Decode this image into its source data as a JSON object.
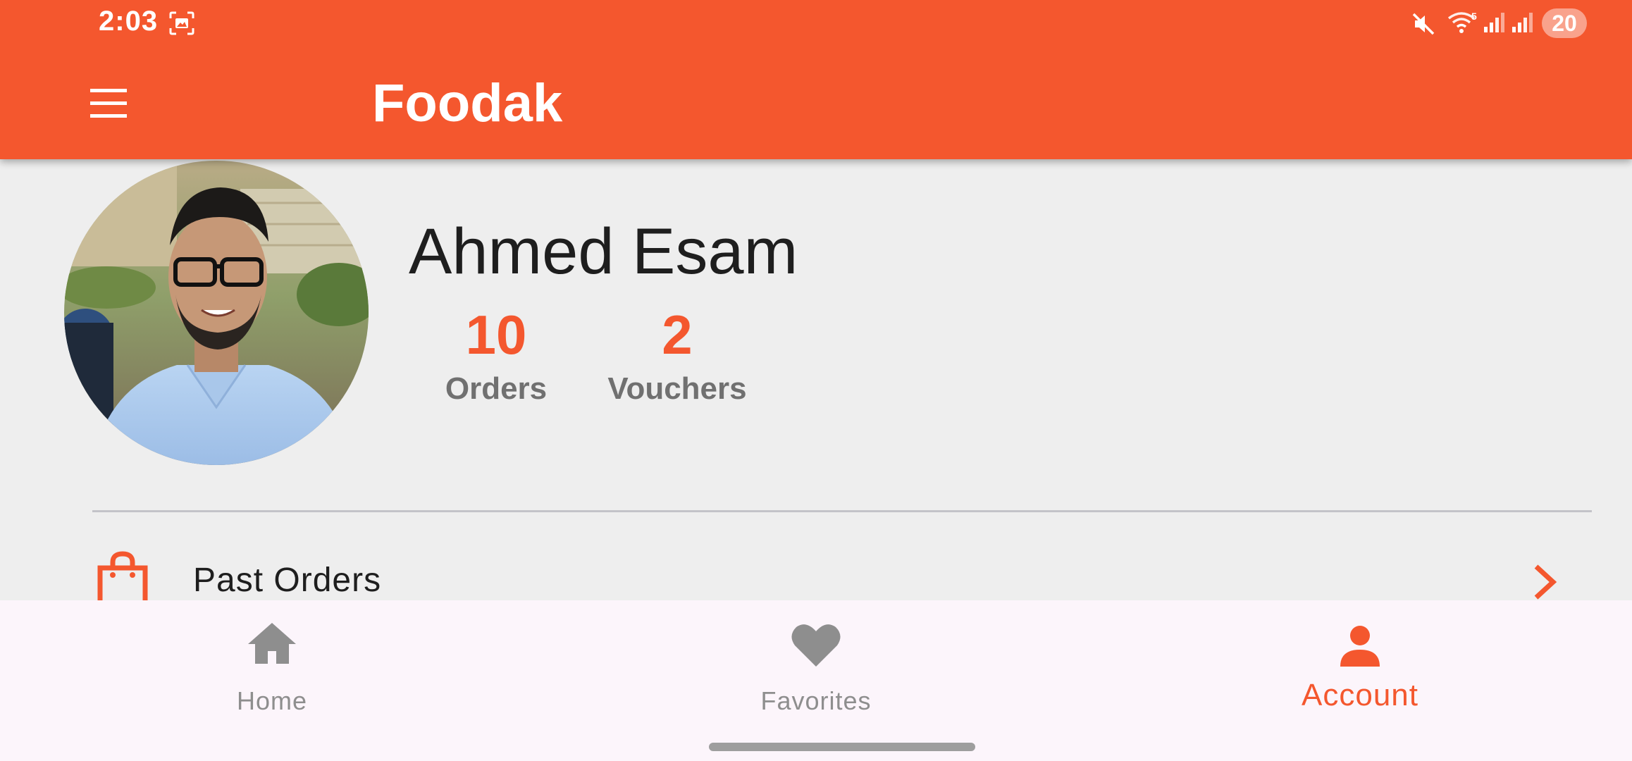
{
  "status_bar": {
    "time": "2:03",
    "network_label": "5",
    "battery": "20"
  },
  "app_bar": {
    "title": "Foodak",
    "menu_icon": "hamburger-menu-icon"
  },
  "profile": {
    "name": "Ahmed Esam",
    "avatar": "profile-photo",
    "stats": [
      {
        "value": "10",
        "label": "Orders"
      },
      {
        "value": "2",
        "label": "Vouchers"
      }
    ]
  },
  "menu_list": [
    {
      "label": "Past Orders",
      "icon": "shopping-bag-icon",
      "trailing_icon": "chevron-right-icon"
    }
  ],
  "bottom_nav": {
    "items": [
      {
        "label": "Home",
        "icon": "home-icon",
        "active": false
      },
      {
        "label": "Favorites",
        "icon": "heart-icon",
        "active": false
      },
      {
        "label": "Account",
        "icon": "person-icon",
        "active": true
      }
    ]
  },
  "colors": {
    "accent": "#f4572e",
    "background": "#eeeeee",
    "nav_background": "#fcf5fb",
    "inactive": "#8e8e8e"
  }
}
